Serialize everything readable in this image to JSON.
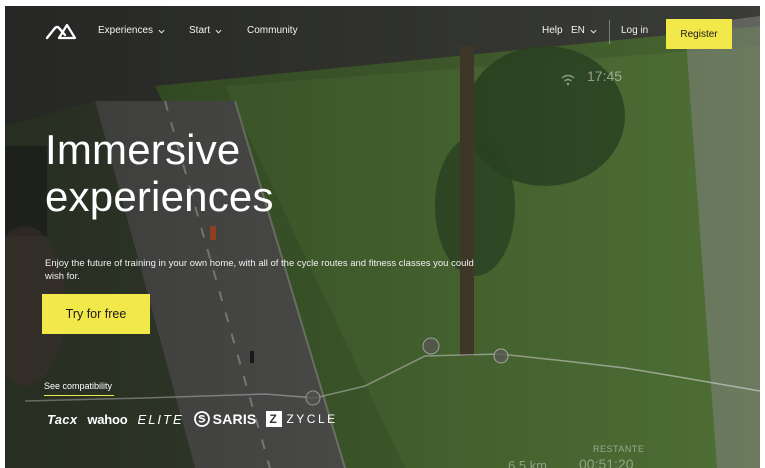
{
  "nav": {
    "experiences_label": "Experiences",
    "start_label": "Start",
    "community_label": "Community",
    "help_label": "Help",
    "language_label": "EN",
    "login_label": "Log in",
    "register_label": "Register"
  },
  "hero": {
    "title_line1": "Immersive",
    "title_line2": "experiences",
    "subtitle": "Enjoy the future of training in your own home, with all of the cycle routes and fitness classes you could wish for.",
    "cta_label": "Try for free",
    "compat_link_label": "See compatibility"
  },
  "brands": {
    "tacx": "Tacx",
    "wahoo": "wahoo",
    "elite": "ELITE",
    "saris": "SARIS",
    "zycle_mark": "Z",
    "zycle": "ZYCLE"
  },
  "scene_hud": {
    "clock": "17:45",
    "remaining_label": "RESTANTE",
    "distance": "6.5 km",
    "time_left": "00:51:20"
  },
  "colors": {
    "accent": "#f3e84a",
    "text_light": "#ffffff"
  },
  "icons": [
    "logo-mark",
    "chevron-down-icon",
    "wifi-icon"
  ]
}
